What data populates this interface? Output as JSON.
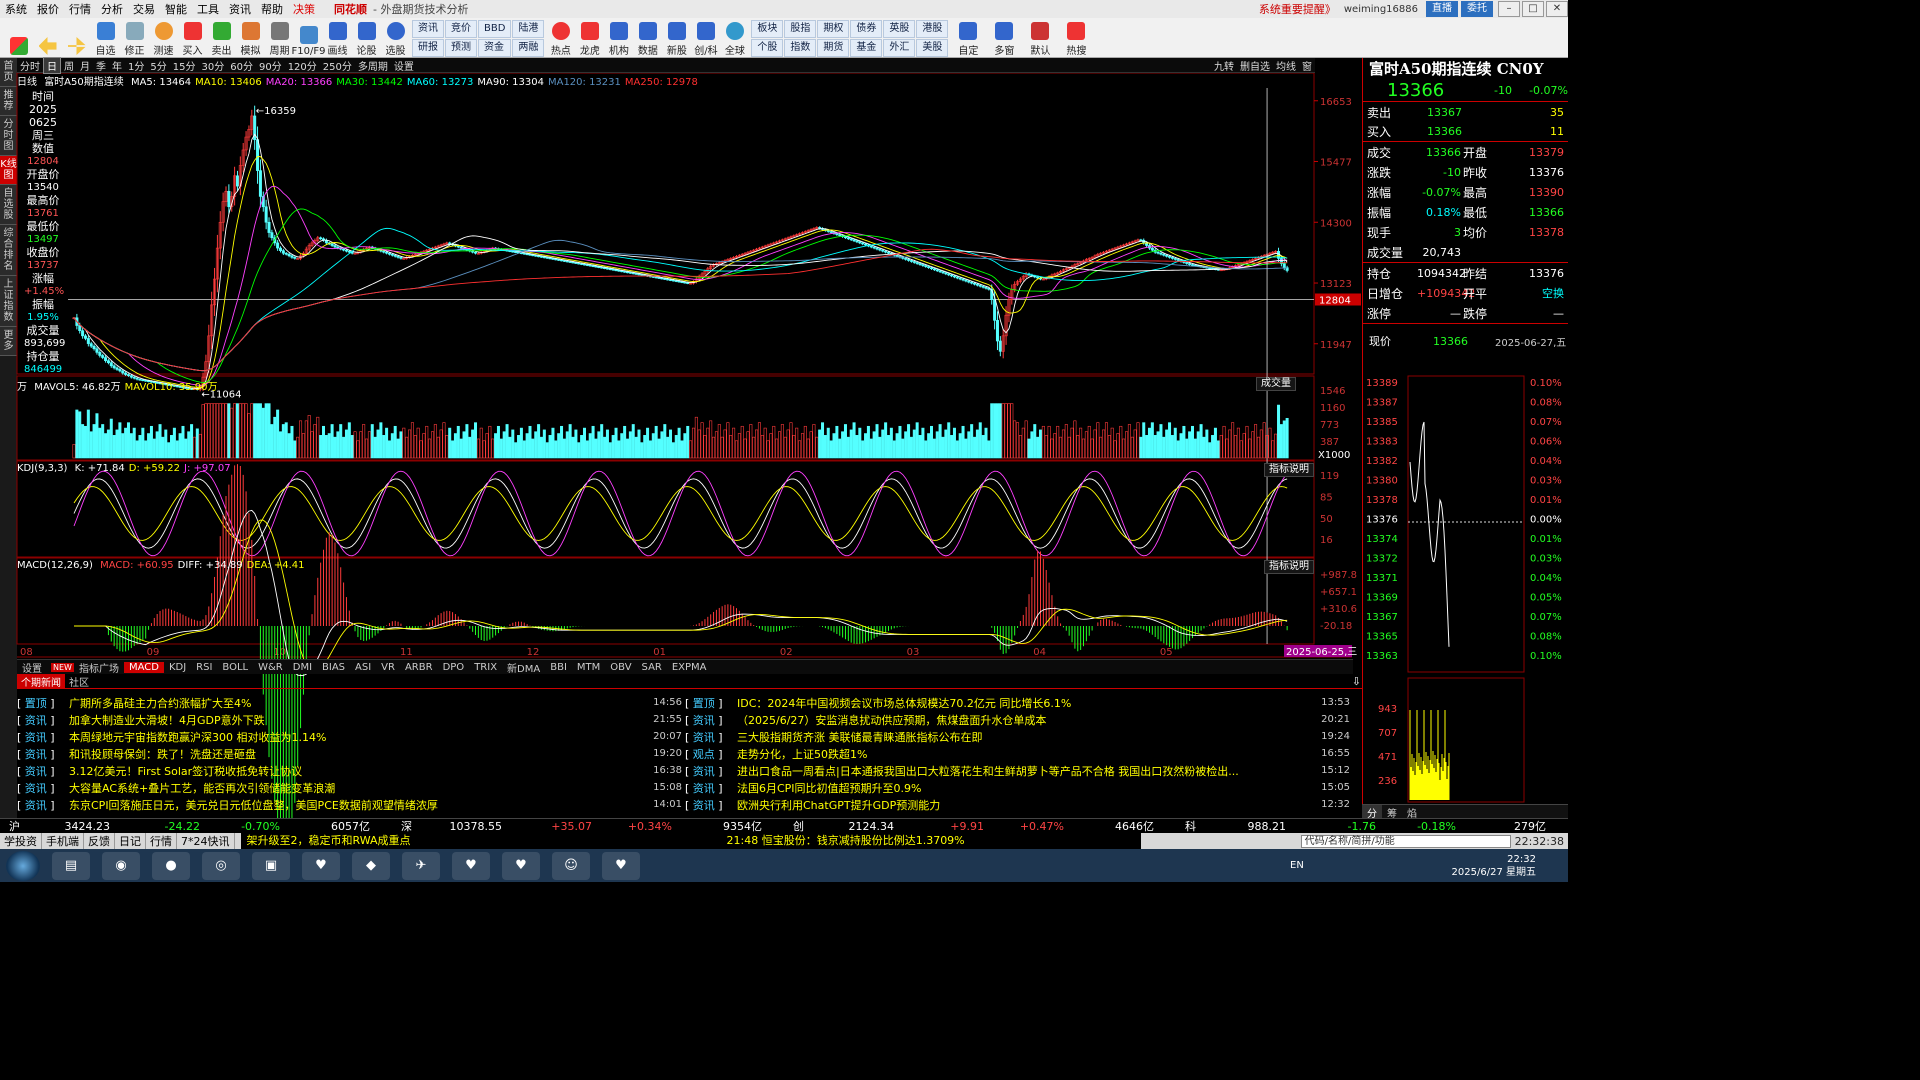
{
  "app": {
    "menus": [
      "系统",
      "报价",
      "行情",
      "分析",
      "交易",
      "智能",
      "工具",
      "资讯",
      "帮助",
      "决策"
    ],
    "brand": "同花顺",
    "subtitle": "- 外盘期货技术分析",
    "notice": "系统重要提醒》",
    "user": "weiming16886",
    "btn_live": "直播",
    "btn_delegate": "委托"
  },
  "toolbar": {
    "buttons": [
      "自选",
      "修正",
      "测速",
      "买入",
      "卖出",
      "模拟",
      "周期",
      "F10/F9",
      "画线",
      "论股",
      "选股"
    ],
    "groups": [
      [
        "资讯",
        "研报"
      ],
      [
        "竞价",
        "预测"
      ],
      [
        "BBD",
        "资金"
      ],
      [
        "陆港",
        "两融"
      ]
    ],
    "buttons2": [
      "热点",
      "龙虎",
      "机构",
      "数据",
      "新股",
      "创/科",
      "全球"
    ],
    "groups2": [
      [
        "板块",
        "个股"
      ],
      [
        "股指",
        "指数"
      ],
      [
        "期权",
        "期货"
      ],
      [
        "债券",
        "基金"
      ],
      [
        "英股",
        "外汇"
      ],
      [
        "港股",
        "美股"
      ]
    ],
    "buttons3": [
      "自定",
      "多窗",
      "默认",
      "热搜"
    ]
  },
  "leftnav": [
    "首页",
    "推荐",
    "分时图",
    "K线图",
    "自选股",
    "综合排名",
    "上证指数",
    "更多"
  ],
  "periods": [
    "分时",
    "日",
    "周",
    "月",
    "季",
    "年",
    "1分",
    "5分",
    "15分",
    "30分",
    "60分",
    "90分",
    "120分",
    "250分",
    "多周期",
    "设置"
  ],
  "period_right": [
    "九转",
    "删自选",
    "均线",
    "窗"
  ],
  "ma_legend": {
    "label": "日线",
    "instrument": "富时A50期指连续",
    "items": [
      {
        "t": "MA5: 13464",
        "c": "#ffffff"
      },
      {
        "t": "MA10: 13406",
        "c": "#ffff00"
      },
      {
        "t": "MA20: 13366",
        "c": "#ff40ff"
      },
      {
        "t": "MA30: 13442",
        "c": "#00ff00"
      },
      {
        "t": "MA60: 13273",
        "c": "#00ffff"
      },
      {
        "t": "MA90: 13304",
        "c": "#ffffff"
      },
      {
        "t": "MA120: 13231",
        "c": "#5a8fbf"
      },
      {
        "t": "MA250: 12978",
        "c": "#ff3030"
      }
    ]
  },
  "info": {
    "rows": [
      [
        "时间",
        ""
      ],
      [
        "2025",
        ""
      ],
      [
        "0625",
        ""
      ],
      [
        "周三",
        ""
      ],
      [
        "数值",
        "12804",
        "red"
      ],
      [
        "开盘价",
        "13540",
        "white"
      ],
      [
        "最高价",
        "13761",
        "red"
      ],
      [
        "最低价",
        "13497",
        "grn"
      ],
      [
        "收盘价",
        "13737",
        "red"
      ],
      [
        "涨幅",
        "+1.45%",
        "red"
      ],
      [
        "振幅",
        "1.95%",
        "cyan"
      ],
      [
        "成交量",
        "893,699",
        "white"
      ],
      [
        "持仓量",
        "846499",
        "cyan"
      ]
    ]
  },
  "volume_legend": {
    "prefix": "万",
    "items": [
      {
        "t": "MAVOL5: 46.82万",
        "c": "#ffffff"
      },
      {
        "t": "MAVOL10: 35.90万",
        "c": "#ffff00"
      }
    ],
    "button": "成交量"
  },
  "kdj_legend": {
    "prefix": "KDJ(9,3,3)",
    "items": [
      {
        "t": "K: +71.84",
        "c": "#ffffff"
      },
      {
        "t": "D: +59.22",
        "c": "#ffff00"
      },
      {
        "t": "J: +97.07",
        "c": "#ff40ff"
      }
    ],
    "button": "指标说明"
  },
  "macd_legend": {
    "prefix": "MACD(12,26,9)",
    "items": [
      {
        "t": "MACD: +60.95",
        "c": "#ff4444"
      },
      {
        "t": "DIFF: +34.89",
        "c": "#ffffff"
      },
      {
        "t": "DEA: +4.41",
        "c": "#ffff00"
      }
    ],
    "button": "指标说明"
  },
  "indicator_tabs": [
    "设置",
    "指标广场",
    "MACD",
    "KDJ",
    "RSI",
    "BOLL",
    "W&R",
    "DMI",
    "BIAS",
    "ASI",
    "VR",
    "ARBR",
    "DPO",
    "TRIX",
    "新DMA",
    "BBI",
    "MTM",
    "OBV",
    "SAR",
    "EXPMA"
  ],
  "indicator_new_badge": "NEW",
  "news_tabs": [
    "个期新闻",
    "社区"
  ],
  "news_left": [
    {
      "tag": "置顶",
      "title": "广期所多晶硅主力合约涨幅扩大至4%",
      "time": "14:56"
    },
    {
      "tag": "资讯",
      "title": "加拿大制造业大滑坡！4月GDP意外下跌",
      "time": "21:55"
    },
    {
      "tag": "资讯",
      "title": "本周绿地元宇宙指数跑赢沪深300 相对收益为1.14%",
      "time": "20:07"
    },
    {
      "tag": "资讯",
      "title": "和讯投顾母保剑：跌了！洗盘还是砸盘",
      "time": "19:20"
    },
    {
      "tag": "资讯",
      "title": "3.12亿美元！First Solar签订税收抵免转让协议",
      "time": "16:38"
    },
    {
      "tag": "资讯",
      "title": "大容量AC系统+叠片工艺，能否再次引领储能变革浪潮",
      "time": "15:08"
    },
    {
      "tag": "资讯",
      "title": "东京CPI回落施压日元，美元兑日元低位盘整，美国PCE数据前观望情绪浓厚",
      "time": "14:01"
    }
  ],
  "news_right": [
    {
      "tag": "置顶",
      "title": "IDC：2024年中国视频会议市场总体规模达70.2亿元 同比增长6.1%",
      "time": "13:53"
    },
    {
      "tag": "资讯",
      "title": "（2025/6/27）安监消息扰动供应预期，焦煤盘面升水仓单成本",
      "time": "20:21"
    },
    {
      "tag": "资讯",
      "title": "三大股指期货齐涨 美联储最青睐通胀指标公布在即",
      "time": "19:24"
    },
    {
      "tag": "观点",
      "title": "走势分化，上证50跌超1%",
      "time": "16:55"
    },
    {
      "tag": "资讯",
      "title": "进出口食品一周看点|日本通报我国出口大粒落花生和生鲜胡萝卜等产品不合格 我国出口孜然粉被检出...",
      "time": "15:12"
    },
    {
      "tag": "资讯",
      "title": "法国6月CPI同比初值超预期升至0.9%",
      "time": "15:05"
    },
    {
      "tag": "资讯",
      "title": "欧洲央行利用ChatGPT提升GDP预测能力",
      "time": "12:32"
    }
  ],
  "quote": {
    "name": "富时A50期指连续 CN0Y",
    "last": "13366",
    "change": "-10",
    "change_pct": "-0.07%",
    "sell": [
      "卖出",
      "13367",
      "35"
    ],
    "buy": [
      "买入",
      "13366",
      "11"
    ],
    "rows": [
      [
        "成交",
        "13366",
        "g",
        "开盘",
        "13379",
        "r"
      ],
      [
        "涨跌",
        "-10",
        "g",
        "昨收",
        "13376",
        "w"
      ],
      [
        "涨幅",
        "-0.07%",
        "g",
        "最高",
        "13390",
        "r"
      ],
      [
        "振幅",
        "0.18%",
        "c",
        "最低",
        "13366",
        "g"
      ],
      [
        "现手",
        "3",
        "g",
        "均价",
        "13378",
        "r"
      ],
      [
        "成交量",
        "20,743",
        "w",
        "",
        "",
        ""
      ]
    ],
    "rows2": [
      [
        "持仓",
        "1094342",
        "w",
        "昨结",
        "13376",
        "w"
      ],
      [
        "日增仓",
        "+1094342",
        "r",
        "开平",
        "空换",
        "c"
      ],
      [
        "涨停",
        "—",
        "w",
        "跌停",
        "—",
        "w"
      ]
    ],
    "now_label": "现价",
    "now_val": "13366",
    "date": "2025-06-27,五"
  },
  "mini_chart": {
    "prices": [
      "13389",
      "13387",
      "13385",
      "13383",
      "13382",
      "13380",
      "13378",
      "13376",
      "13374",
      "13372",
      "13371",
      "13369",
      "13367",
      "13365",
      "13363"
    ],
    "pcts": [
      "0.10%",
      "0.08%",
      "0.07%",
      "0.06%",
      "0.04%",
      "0.03%",
      "0.01%",
      "0.00%",
      "0.01%",
      "0.03%",
      "0.04%",
      "0.05%",
      "0.07%",
      "0.08%",
      "0.10%"
    ],
    "vol": [
      "943",
      "707",
      "471",
      "236"
    ],
    "tabs": [
      "分",
      "筹",
      "焰"
    ],
    "bottom_pct": "-0.18%",
    "bottom_vol": "279亿"
  },
  "ticker": [
    {
      "n": "沪",
      "v": "3424.23",
      "c": "-24.22",
      "p": "-0.70%",
      "a": "6057亿",
      "cc": "#2f2"
    },
    {
      "n": "深",
      "v": "10378.55",
      "c": "+35.07",
      "p": "+0.34%",
      "a": "9354亿",
      "cc": "#f44"
    },
    {
      "n": "创",
      "v": "2124.34",
      "c": "+9.91",
      "p": "+0.47%",
      "a": "4646亿",
      "cc": "#f44"
    },
    {
      "n": "科",
      "v": "988.21",
      "c": "-1.76",
      "p": "-0.18%",
      "a": "279亿",
      "cc": "#2f2"
    }
  ],
  "clock": "22:32:38",
  "bottombar": {
    "items": [
      "学投资",
      "手机端",
      "反馈",
      "日记",
      "行情",
      "7*24快讯"
    ],
    "marquee": "架升级至2，稳定币和RWA成重点",
    "marquee2": "21:48 恒宝股份：钱京减持股份比例达1.3709%",
    "search": "代码/名称/简拼/功能"
  },
  "taskbar": {
    "time": "22:32",
    "date": "2025/6/27 星期五",
    "lang": "EN"
  },
  "chart_data": [
    {
      "type": "candlestick",
      "title": "富时A50期指连续 日线",
      "x_labels": [
        "08",
        "09",
        "10",
        "11",
        "12",
        "01",
        "02",
        "03",
        "04",
        "05",
        "06"
      ],
      "ylim": [
        11400,
        16900
      ],
      "y_ticks": [
        16653,
        15477,
        14300,
        13123,
        11947
      ],
      "hline": 12804,
      "annotations": [
        {
          "label": "16359",
          "value": 16359
        },
        {
          "label": "11064",
          "value": 11064
        }
      ],
      "cursor_label": "2025-06-25,三",
      "closes": [
        12450,
        12300,
        12200,
        12100,
        12050,
        11950,
        11900,
        11850,
        11780,
        11720,
        11680,
        11620,
        11580,
        11520,
        11480,
        11450,
        11420,
        11380,
        11350,
        11330,
        11300,
        11280,
        11260,
        11250,
        11240,
        11230,
        11220,
        11210,
        11200,
        11190,
        11180,
        11170,
        11160,
        11150,
        11140,
        11130,
        11120,
        11110,
        11100,
        11090,
        11080,
        11070,
        11080,
        11064,
        11120,
        11300,
        11600,
        12100,
        12700,
        13200,
        13800,
        14300,
        14700,
        14900,
        14600,
        14800,
        15200,
        15000,
        15400,
        15700,
        15950,
        16100,
        16359,
        15900,
        15300,
        14800,
        14600,
        14300,
        14100,
        14000,
        13900,
        13800,
        13750,
        13700,
        13680,
        13650,
        13620,
        13600,
        13600,
        13650,
        13700,
        13780,
        13850,
        13900,
        13950,
        14000,
        13980,
        13950,
        13900,
        13880,
        13850,
        13820,
        13800,
        13780,
        13760,
        13740,
        13720,
        13700,
        13700,
        13720,
        13750,
        13780,
        13800,
        13820,
        13800,
        13780,
        13760,
        13740,
        13720,
        13700,
        13680,
        13660,
        13640,
        13620,
        13600,
        13600,
        13620,
        13640,
        13660,
        13680,
        13700,
        13720,
        13740,
        13760,
        13780,
        13800,
        13820,
        13840,
        13860,
        13880,
        13900,
        13880,
        13860,
        13840,
        13820,
        13800,
        13780,
        13760,
        13740,
        13720,
        13700,
        13700,
        13720,
        13740,
        13760,
        13780,
        13800,
        13790,
        13780,
        13770,
        13760,
        13750,
        13740,
        13730,
        13720,
        13710,
        13700,
        13690,
        13680,
        13670,
        13660,
        13650,
        13640,
        13630,
        13620,
        13610,
        13600,
        13590,
        13580,
        13570,
        13560,
        13550,
        13540,
        13530,
        13520,
        13510,
        13500,
        13490,
        13480,
        13470,
        13460,
        13450,
        13440,
        13430,
        13420,
        13410,
        13400,
        13390,
        13380,
        13370,
        13360,
        13350,
        13340,
        13330,
        13320,
        13310,
        13300,
        13290,
        13280,
        13270,
        13260,
        13250,
        13240,
        13230,
        13220,
        13210,
        13200,
        13190,
        13180,
        13170,
        13160,
        13150,
        13140,
        13130,
        13120,
        13120,
        13150,
        13200,
        13250,
        13300,
        13350,
        13400,
        13450,
        13480,
        13500,
        13520,
        13540,
        13560,
        13580,
        13600,
        13620,
        13640,
        13660,
        13680,
        13700,
        13720,
        13740,
        13760,
        13780,
        13800,
        13820,
        13840,
        13860,
        13880,
        13900,
        13920,
        13940,
        13960,
        13980,
        14000,
        14020,
        14040,
        14060,
        14080,
        14100,
        14120,
        14140,
        14160,
        14180,
        14200,
        14180,
        14160,
        14140,
        14120,
        14100,
        14080,
        14060,
        14040,
        14020,
        14000,
        13980,
        13960,
        13940,
        13920,
        13900,
        13880,
        13860,
        13840,
        13820,
        13800,
        13780,
        13760,
        13740,
        13720,
        13700,
        13680,
        13660,
        13640,
        13620,
        13600,
        13580,
        13560,
        13540,
        13520,
        13500,
        13480,
        13460,
        13440,
        13420,
        13400,
        13380,
        13360,
        13340,
        13320,
        13300,
        13280,
        13260,
        13240,
        13220,
        13200,
        13180,
        13160,
        13140,
        13120,
        13100,
        13080,
        13060,
        13040,
        13020,
        13000,
        12800,
        12400,
        12000,
        11800,
        12100,
        12500,
        12800,
        13000,
        13100,
        13150,
        13200,
        13250,
        13300,
        13280,
        13260,
        13240,
        13220,
        13200,
        13200,
        13220,
        13250,
        13280,
        13300,
        13320,
        13350,
        13380,
        13400,
        13420,
        13450,
        13480,
        13500,
        13520,
        13550,
        13580,
        13600,
        13620,
        13650,
        13680,
        13700,
        13720,
        13740,
        13760,
        13780,
        13800,
        13820,
        13840,
        13860,
        13880,
        13900,
        13920,
        13940,
        13960,
        13950,
        13900,
        13850,
        13800,
        13760,
        13720,
        13700,
        13680,
        13660,
        13640,
        13620,
        13600,
        13580,
        13560,
        13540,
        13520,
        13500,
        13480,
        13470,
        13460,
        13450,
        13440,
        13430,
        13420,
        13410,
        13400,
        13390,
        13380,
        13380,
        13390,
        13400,
        13420,
        13440,
        13460,
        13480,
        13500,
        13520,
        13540,
        13560,
        13580,
        13600,
        13620,
        13640,
        13660,
        13680,
        13700,
        13720,
        13737,
        13600,
        13500,
        13420,
        13366
      ],
      "volume_ticks": [
        1546,
        1160,
        773,
        387
      ],
      "kdj_ticks": [
        119,
        85,
        50,
        16
      ],
      "macd_ticks": [
        "+987.8",
        "+657.1",
        "+310.6",
        "-20.18"
      ],
      "volume_unit": "X1000"
    }
  ]
}
